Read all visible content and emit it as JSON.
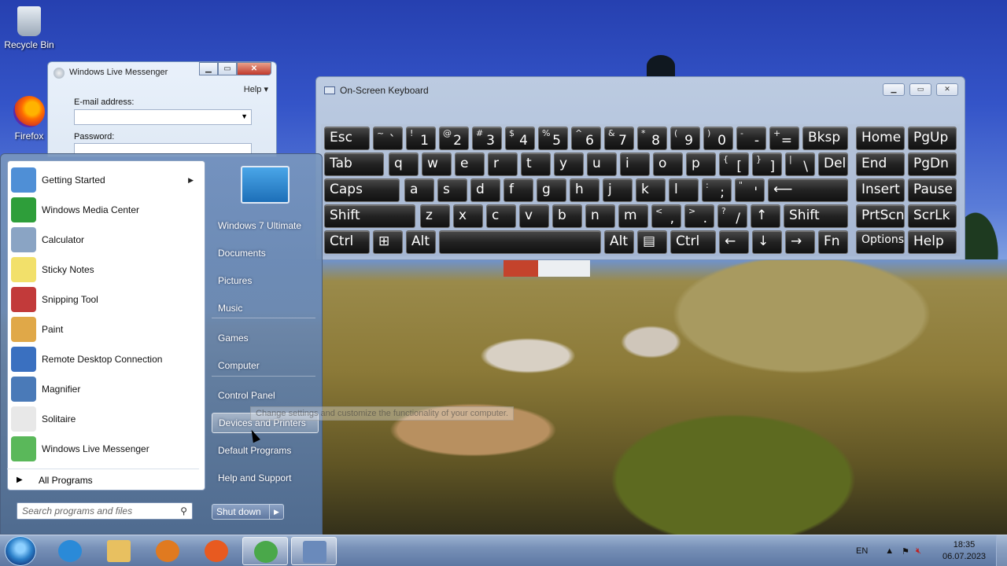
{
  "desktop": {
    "icons": [
      {
        "label": "Recycle Bin",
        "icon": "recycle-bin-icon"
      },
      {
        "label": "Firefox",
        "icon": "firefox-icon"
      }
    ]
  },
  "messenger": {
    "title": "Windows Live Messenger",
    "help": "Help",
    "email_label": "E-mail address:",
    "password_label": "Password:"
  },
  "osk": {
    "title": "On-Screen Keyboard",
    "rows": [
      [
        [
          "Esc",
          ""
        ],
        [
          "~",
          "`"
        ],
        [
          "!",
          "1"
        ],
        [
          "@",
          "2"
        ],
        [
          "#",
          "3"
        ],
        [
          "$",
          "4"
        ],
        [
          "%",
          "5"
        ],
        [
          "^",
          "6"
        ],
        [
          "&",
          "7"
        ],
        [
          "*",
          "8"
        ],
        [
          "(",
          "9"
        ],
        [
          ")",
          "0"
        ],
        [
          "-",
          "-"
        ],
        [
          "+",
          "="
        ],
        [
          "Bksp",
          ""
        ],
        [
          "Home",
          ""
        ],
        [
          "PgUp",
          ""
        ]
      ],
      [
        [
          "Tab",
          ""
        ],
        [
          "q",
          ""
        ],
        [
          "w",
          ""
        ],
        [
          "e",
          ""
        ],
        [
          "r",
          ""
        ],
        [
          "t",
          ""
        ],
        [
          "y",
          ""
        ],
        [
          "u",
          ""
        ],
        [
          "i",
          ""
        ],
        [
          "o",
          ""
        ],
        [
          "p",
          ""
        ],
        [
          "{",
          "["
        ],
        [
          "}",
          "]"
        ],
        [
          "|",
          "\\"
        ],
        [
          "Del",
          ""
        ],
        [
          "End",
          ""
        ],
        [
          "PgDn",
          ""
        ]
      ],
      [
        [
          "Caps",
          ""
        ],
        [
          "a",
          ""
        ],
        [
          "s",
          ""
        ],
        [
          "d",
          ""
        ],
        [
          "f",
          ""
        ],
        [
          "g",
          ""
        ],
        [
          "h",
          ""
        ],
        [
          "j",
          ""
        ],
        [
          "k",
          ""
        ],
        [
          "l",
          ""
        ],
        [
          ":",
          ";"
        ],
        [
          "\"",
          "'"
        ],
        [
          "⟵",
          ""
        ],
        [
          "Insert",
          ""
        ],
        [
          "Pause",
          ""
        ]
      ],
      [
        [
          "Shift",
          ""
        ],
        [
          "z",
          ""
        ],
        [
          "x",
          ""
        ],
        [
          "c",
          ""
        ],
        [
          "v",
          ""
        ],
        [
          "b",
          ""
        ],
        [
          "n",
          ""
        ],
        [
          "m",
          ""
        ],
        [
          "<",
          ","
        ],
        [
          ">",
          "."
        ],
        [
          "?",
          "/"
        ],
        [
          "↑",
          ""
        ],
        [
          "Shift",
          ""
        ],
        [
          "PrtScn",
          ""
        ],
        [
          "ScrLk",
          ""
        ]
      ],
      [
        [
          "Ctrl",
          ""
        ],
        [
          "⊞",
          ""
        ],
        [
          "Alt",
          ""
        ],
        [
          "",
          ""
        ],
        [
          "Alt",
          ""
        ],
        [
          "▤",
          ""
        ],
        [
          "Ctrl",
          ""
        ],
        [
          "←",
          ""
        ],
        [
          "↓",
          ""
        ],
        [
          "→",
          ""
        ],
        [
          "Fn",
          ""
        ],
        [
          "Options",
          ""
        ],
        [
          "Help",
          ""
        ]
      ]
    ]
  },
  "start_menu": {
    "programs": [
      {
        "label": "Getting Started",
        "icon": "getting-started-icon",
        "submenu": true,
        "color": "#4f8fd6"
      },
      {
        "label": "Windows Media Center",
        "icon": "media-center-icon",
        "submenu": false,
        "color": "#2e9e3a"
      },
      {
        "label": "Calculator",
        "icon": "calculator-icon",
        "submenu": false,
        "color": "#8aa4c4"
      },
      {
        "label": "Sticky Notes",
        "icon": "sticky-notes-icon",
        "submenu": false,
        "color": "#f2e06a"
      },
      {
        "label": "Snipping Tool",
        "icon": "snipping-tool-icon",
        "submenu": false,
        "color": "#c23a3a"
      },
      {
        "label": "Paint",
        "icon": "paint-icon",
        "submenu": false,
        "color": "#e0a848"
      },
      {
        "label": "Remote Desktop Connection",
        "icon": "remote-desktop-icon",
        "submenu": false,
        "color": "#3a70c0"
      },
      {
        "label": "Magnifier",
        "icon": "magnifier-icon",
        "submenu": false,
        "color": "#4a7ab8"
      },
      {
        "label": "Solitaire",
        "icon": "solitaire-icon",
        "submenu": false,
        "color": "#e8e8e8"
      },
      {
        "label": "Windows Live Messenger",
        "icon": "messenger-icon",
        "submenu": false,
        "color": "#5ab85a"
      }
    ],
    "all_programs": "All Programs",
    "search_placeholder": "Search programs and files",
    "right": [
      "Windows 7 Ultimate",
      "Documents",
      "Pictures",
      "Music",
      "Games",
      "Computer",
      "Control Panel",
      "Devices and Printers",
      "Default Programs",
      "Help and Support"
    ],
    "shutdown": "Shut down",
    "tooltip": "Change settings and customize the functionality of your computer."
  },
  "taskbar": {
    "language": "EN",
    "time": "18:35",
    "date": "06.07.2023",
    "buttons": [
      {
        "icon": "internet-explorer-icon",
        "active": false,
        "color": "#2a8ad8"
      },
      {
        "icon": "file-explorer-icon",
        "active": false,
        "color": "#e8c060"
      },
      {
        "icon": "media-player-icon",
        "active": false,
        "color": "#e07a20"
      },
      {
        "icon": "firefox-icon",
        "active": false,
        "color": "#e85a20"
      },
      {
        "icon": "messenger-icon",
        "active": true,
        "color": "#4aa84a"
      },
      {
        "icon": "on-screen-keyboard-icon",
        "active": true,
        "color": "#6a8abb"
      }
    ]
  }
}
